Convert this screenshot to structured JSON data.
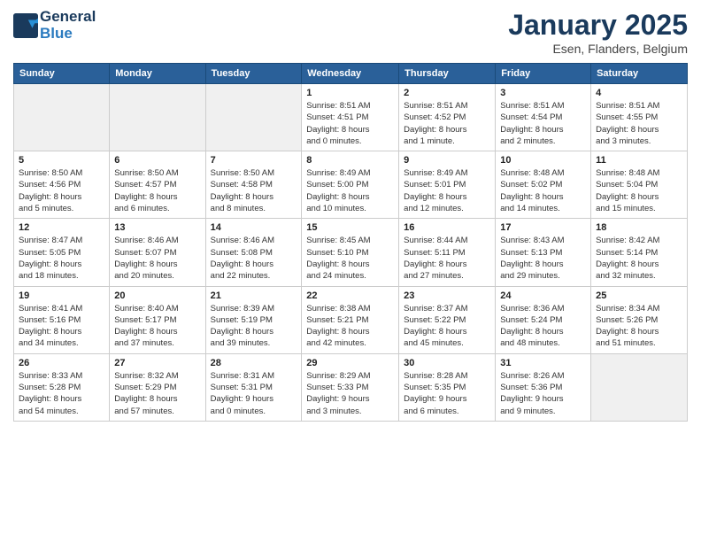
{
  "header": {
    "logo_line1": "General",
    "logo_line2": "Blue",
    "month_title": "January 2025",
    "location": "Esen, Flanders, Belgium"
  },
  "weekdays": [
    "Sunday",
    "Monday",
    "Tuesday",
    "Wednesday",
    "Thursday",
    "Friday",
    "Saturday"
  ],
  "weeks": [
    [
      {
        "day": "",
        "info": "",
        "empty": true
      },
      {
        "day": "",
        "info": "",
        "empty": true
      },
      {
        "day": "",
        "info": "",
        "empty": true
      },
      {
        "day": "1",
        "info": "Sunrise: 8:51 AM\nSunset: 4:51 PM\nDaylight: 8 hours\nand 0 minutes.",
        "empty": false
      },
      {
        "day": "2",
        "info": "Sunrise: 8:51 AM\nSunset: 4:52 PM\nDaylight: 8 hours\nand 1 minute.",
        "empty": false
      },
      {
        "day": "3",
        "info": "Sunrise: 8:51 AM\nSunset: 4:54 PM\nDaylight: 8 hours\nand 2 minutes.",
        "empty": false
      },
      {
        "day": "4",
        "info": "Sunrise: 8:51 AM\nSunset: 4:55 PM\nDaylight: 8 hours\nand 3 minutes.",
        "empty": false
      }
    ],
    [
      {
        "day": "5",
        "info": "Sunrise: 8:50 AM\nSunset: 4:56 PM\nDaylight: 8 hours\nand 5 minutes.",
        "empty": false
      },
      {
        "day": "6",
        "info": "Sunrise: 8:50 AM\nSunset: 4:57 PM\nDaylight: 8 hours\nand 6 minutes.",
        "empty": false
      },
      {
        "day": "7",
        "info": "Sunrise: 8:50 AM\nSunset: 4:58 PM\nDaylight: 8 hours\nand 8 minutes.",
        "empty": false
      },
      {
        "day": "8",
        "info": "Sunrise: 8:49 AM\nSunset: 5:00 PM\nDaylight: 8 hours\nand 10 minutes.",
        "empty": false
      },
      {
        "day": "9",
        "info": "Sunrise: 8:49 AM\nSunset: 5:01 PM\nDaylight: 8 hours\nand 12 minutes.",
        "empty": false
      },
      {
        "day": "10",
        "info": "Sunrise: 8:48 AM\nSunset: 5:02 PM\nDaylight: 8 hours\nand 14 minutes.",
        "empty": false
      },
      {
        "day": "11",
        "info": "Sunrise: 8:48 AM\nSunset: 5:04 PM\nDaylight: 8 hours\nand 15 minutes.",
        "empty": false
      }
    ],
    [
      {
        "day": "12",
        "info": "Sunrise: 8:47 AM\nSunset: 5:05 PM\nDaylight: 8 hours\nand 18 minutes.",
        "empty": false
      },
      {
        "day": "13",
        "info": "Sunrise: 8:46 AM\nSunset: 5:07 PM\nDaylight: 8 hours\nand 20 minutes.",
        "empty": false
      },
      {
        "day": "14",
        "info": "Sunrise: 8:46 AM\nSunset: 5:08 PM\nDaylight: 8 hours\nand 22 minutes.",
        "empty": false
      },
      {
        "day": "15",
        "info": "Sunrise: 8:45 AM\nSunset: 5:10 PM\nDaylight: 8 hours\nand 24 minutes.",
        "empty": false
      },
      {
        "day": "16",
        "info": "Sunrise: 8:44 AM\nSunset: 5:11 PM\nDaylight: 8 hours\nand 27 minutes.",
        "empty": false
      },
      {
        "day": "17",
        "info": "Sunrise: 8:43 AM\nSunset: 5:13 PM\nDaylight: 8 hours\nand 29 minutes.",
        "empty": false
      },
      {
        "day": "18",
        "info": "Sunrise: 8:42 AM\nSunset: 5:14 PM\nDaylight: 8 hours\nand 32 minutes.",
        "empty": false
      }
    ],
    [
      {
        "day": "19",
        "info": "Sunrise: 8:41 AM\nSunset: 5:16 PM\nDaylight: 8 hours\nand 34 minutes.",
        "empty": false
      },
      {
        "day": "20",
        "info": "Sunrise: 8:40 AM\nSunset: 5:17 PM\nDaylight: 8 hours\nand 37 minutes.",
        "empty": false
      },
      {
        "day": "21",
        "info": "Sunrise: 8:39 AM\nSunset: 5:19 PM\nDaylight: 8 hours\nand 39 minutes.",
        "empty": false
      },
      {
        "day": "22",
        "info": "Sunrise: 8:38 AM\nSunset: 5:21 PM\nDaylight: 8 hours\nand 42 minutes.",
        "empty": false
      },
      {
        "day": "23",
        "info": "Sunrise: 8:37 AM\nSunset: 5:22 PM\nDaylight: 8 hours\nand 45 minutes.",
        "empty": false
      },
      {
        "day": "24",
        "info": "Sunrise: 8:36 AM\nSunset: 5:24 PM\nDaylight: 8 hours\nand 48 minutes.",
        "empty": false
      },
      {
        "day": "25",
        "info": "Sunrise: 8:34 AM\nSunset: 5:26 PM\nDaylight: 8 hours\nand 51 minutes.",
        "empty": false
      }
    ],
    [
      {
        "day": "26",
        "info": "Sunrise: 8:33 AM\nSunset: 5:28 PM\nDaylight: 8 hours\nand 54 minutes.",
        "empty": false
      },
      {
        "day": "27",
        "info": "Sunrise: 8:32 AM\nSunset: 5:29 PM\nDaylight: 8 hours\nand 57 minutes.",
        "empty": false
      },
      {
        "day": "28",
        "info": "Sunrise: 8:31 AM\nSunset: 5:31 PM\nDaylight: 9 hours\nand 0 minutes.",
        "empty": false
      },
      {
        "day": "29",
        "info": "Sunrise: 8:29 AM\nSunset: 5:33 PM\nDaylight: 9 hours\nand 3 minutes.",
        "empty": false
      },
      {
        "day": "30",
        "info": "Sunrise: 8:28 AM\nSunset: 5:35 PM\nDaylight: 9 hours\nand 6 minutes.",
        "empty": false
      },
      {
        "day": "31",
        "info": "Sunrise: 8:26 AM\nSunset: 5:36 PM\nDaylight: 9 hours\nand 9 minutes.",
        "empty": false
      },
      {
        "day": "",
        "info": "",
        "empty": true
      }
    ]
  ]
}
